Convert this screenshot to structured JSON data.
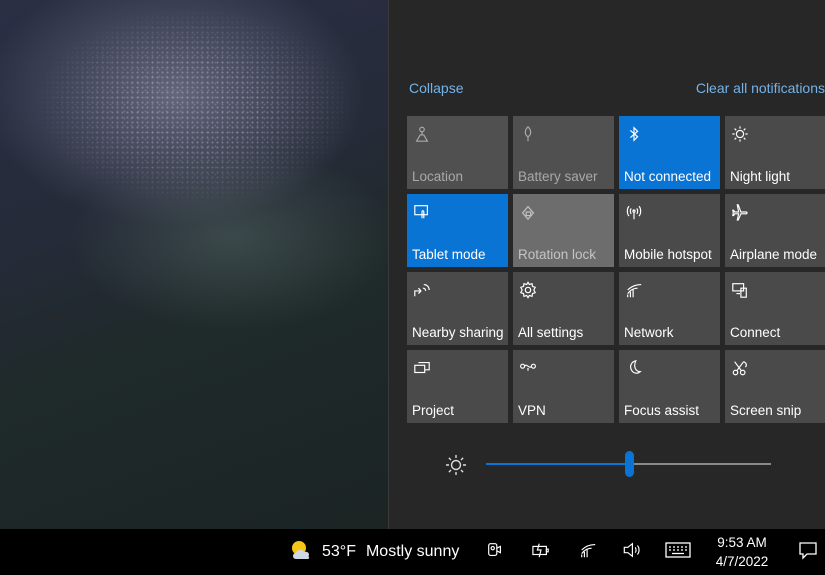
{
  "action_center": {
    "collapse_label": "Collapse",
    "clear_label": "Clear all notifications",
    "tiles": [
      {
        "label": "Location",
        "icon": "location-icon",
        "state": "disabled"
      },
      {
        "label": "Battery saver",
        "icon": "battery-saver-icon",
        "state": "disabled"
      },
      {
        "label": "Not connected",
        "icon": "bluetooth-icon",
        "state": "active"
      },
      {
        "label": "Night light",
        "icon": "night-light-icon",
        "state": "off"
      },
      {
        "label": "Tablet mode",
        "icon": "tablet-mode-icon",
        "state": "active"
      },
      {
        "label": "Rotation lock",
        "icon": "rotation-lock-icon",
        "state": "disabled-light"
      },
      {
        "label": "Mobile hotspot",
        "icon": "mobile-hotspot-icon",
        "state": "off"
      },
      {
        "label": "Airplane mode",
        "icon": "airplane-icon",
        "state": "off"
      },
      {
        "label": "Nearby sharing",
        "icon": "nearby-sharing-icon",
        "state": "off"
      },
      {
        "label": "All settings",
        "icon": "gear-icon",
        "state": "off"
      },
      {
        "label": "Network",
        "icon": "network-icon",
        "state": "off"
      },
      {
        "label": "Connect",
        "icon": "connect-icon",
        "state": "off"
      },
      {
        "label": "Project",
        "icon": "project-icon",
        "state": "off"
      },
      {
        "label": "VPN",
        "icon": "vpn-icon",
        "state": "off"
      },
      {
        "label": "Focus assist",
        "icon": "moon-icon",
        "state": "off"
      },
      {
        "label": "Screen snip",
        "icon": "screen-snip-icon",
        "state": "off"
      }
    ],
    "brightness_fraction": 0.5
  },
  "taskbar": {
    "temperature": "53°F",
    "condition": "Mostly sunny",
    "time": "9:53 AM",
    "date": "4/7/2022"
  },
  "colors": {
    "accent": "#0a74d4",
    "link": "#74b3e8",
    "tile_off": "#4a4a4a",
    "panel": "#272727"
  }
}
